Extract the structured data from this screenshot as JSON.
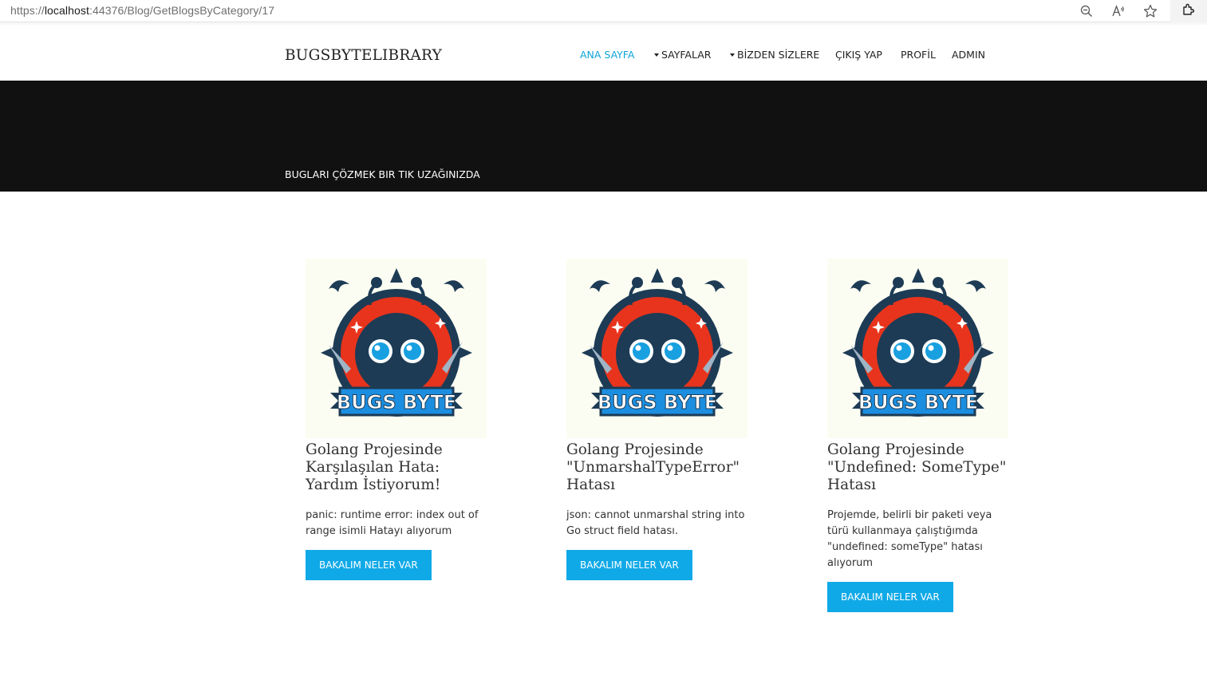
{
  "browser": {
    "url_prefix": "https://",
    "url_host": "localhost",
    "url_path": ":44376/Blog/GetBlogsByCategory/17"
  },
  "header": {
    "brand": "BUGSBYTELIBRARY",
    "nav": [
      {
        "label": "ANA SAYFA",
        "active": true,
        "dropdown": false
      },
      {
        "label": "SAYFALAR",
        "active": false,
        "dropdown": true
      },
      {
        "label": "BİZDEN SİZLERE",
        "active": false,
        "dropdown": true
      },
      {
        "label": "ÇIKIŞ YAP",
        "active": false,
        "dropdown": false
      },
      {
        "label": "PROFİL",
        "active": false,
        "dropdown": false
      },
      {
        "label": "ADMIN",
        "active": false,
        "dropdown": false
      }
    ]
  },
  "hero": {
    "tagline": "BUGLARI ÇÖZMEK BIR TIK UZAĞINIZDA"
  },
  "cards": [
    {
      "logo_text": "BUGS BYTE",
      "title": "Golang Projesinde Karşılaşılan Hata: Yardım İstiyorum!",
      "description": "panic: runtime error: index out of range isimli Hatayı alıyorum",
      "button": "BAKALIM NELER VAR"
    },
    {
      "logo_text": "BUGS BYTE",
      "title": "Golang Projesinde \"UnmarshalTypeError\" Hatası",
      "description": "json: cannot unmarshal string into Go struct field hatası.",
      "button": "BAKALIM NELER VAR"
    },
    {
      "logo_text": "BUGS BYTE",
      "title": "Golang Projesinde \"Undefined: SomeType\" Hatası",
      "description": "Projemde, belirli bir paketi veya türü kullanmaya çalıştığımda \"undefined: someType\" hatası alıyorum",
      "button": "BAKALIM NELER VAR"
    }
  ],
  "colors": {
    "accent": "#10a9e7",
    "hero_bg": "#111111",
    "nav_active": "#0ea5d8"
  },
  "icons": [
    "zoom-out-icon",
    "read-aloud-icon",
    "favorite-star-icon",
    "extensions-icon",
    "bug-mascot-logo"
  ]
}
